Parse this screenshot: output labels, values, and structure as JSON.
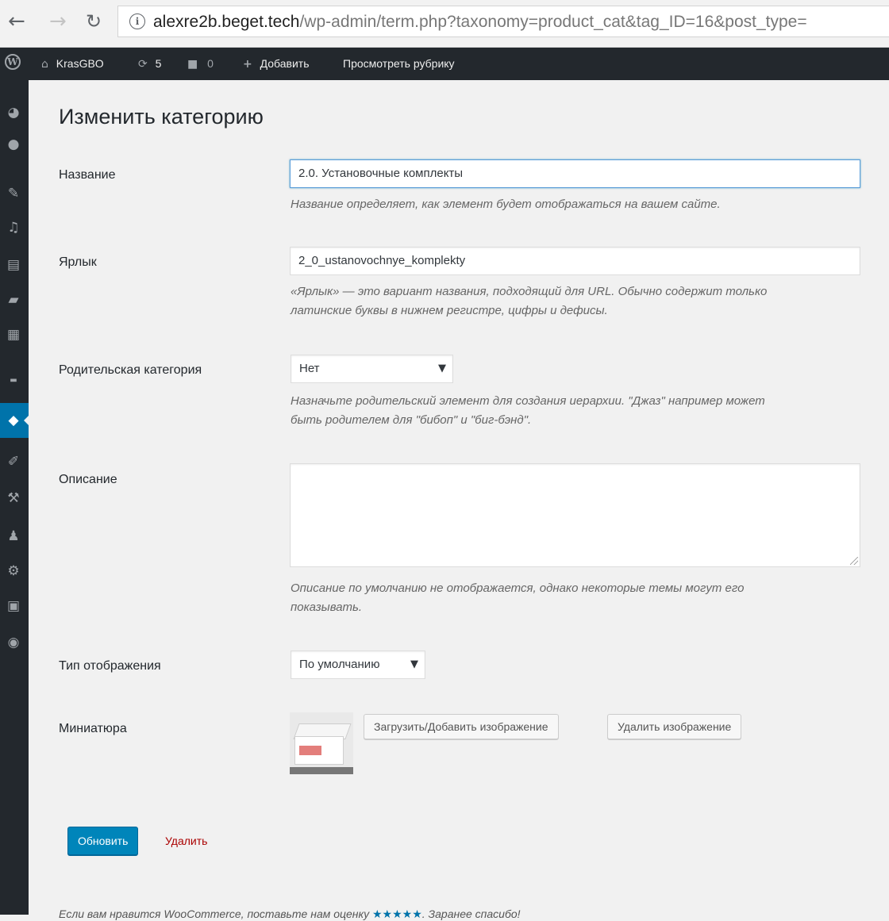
{
  "browser": {
    "url_host": "alexre2b.beget.tech",
    "url_path": "/wp-admin/term.php?taxonomy=product_cat&tag_ID=16&post_type="
  },
  "adminbar": {
    "site_name": "KrasGBO",
    "updates_count": "5",
    "comments_count": "0",
    "add_new_label": "Добавить",
    "view_label": "Просмотреть рубрику"
  },
  "page": {
    "title": "Изменить категорию"
  },
  "form": {
    "name": {
      "label": "Название",
      "value": "2.0. Установочные комплекты",
      "description": "Название определяет, как элемент будет отображаться на вашем сайте."
    },
    "slug": {
      "label": "Ярлык",
      "value": "2_0_ustanovochnye_komplekty",
      "description_line1": "«Ярлык» — это вариант названия, подходящий для URL. Обычно содержит только",
      "description_line2": "латинские буквы в нижнем регистре, цифры и дефисы."
    },
    "parent": {
      "label": "Родительская категория",
      "selected": "Нет",
      "description_line1": "Назначьте родительский элемент для создания иерархии. \"Джаз\" например может",
      "description_line2": "быть родителем для \"бибоп\" и \"биг-бэнд\"."
    },
    "description_field": {
      "label": "Описание",
      "value": "",
      "description_line1": "Описание по умолчанию не отображается, однако некоторые темы могут его",
      "description_line2": "показывать."
    },
    "display_type": {
      "label": "Тип отображения",
      "selected": "По умолчанию"
    },
    "thumbnail": {
      "label": "Миниатюра",
      "upload_label": "Загрузить/Добавить изображение",
      "remove_label": "Удалить изображение"
    }
  },
  "actions": {
    "update_label": "Обновить",
    "delete_label": "Удалить"
  },
  "footer": {
    "text_before": "Если вам нравится WooCommerce, поставьте нам оценку ",
    "stars": "★★★★★",
    "text_after": ". Заранее спасибо!"
  }
}
